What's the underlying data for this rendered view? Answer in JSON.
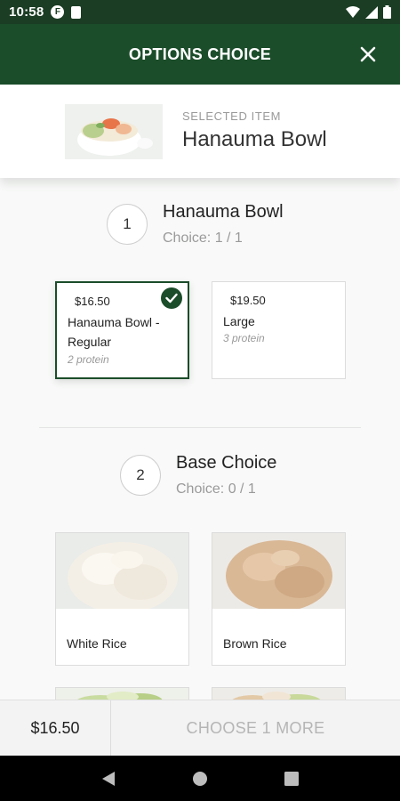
{
  "status_bar": {
    "time": "10:58",
    "app_icon_letter": "F",
    "icons": [
      "wifi-icon",
      "signal-icon",
      "battery-icon"
    ]
  },
  "app_bar": {
    "title": "OPTIONS CHOICE",
    "close_icon": "close-icon"
  },
  "selected_item": {
    "label": "SELECTED ITEM",
    "name": "Hanauma Bowl"
  },
  "sections": [
    {
      "step": "1",
      "title": "Hanauma Bowl",
      "choice_count": "Choice: 1 / 1",
      "options": [
        {
          "price": "$16.50",
          "name": "Hanauma Bowl - Regular",
          "sub": "2 protein",
          "selected": true
        },
        {
          "price": "$19.50",
          "name": "Large",
          "sub": "3 protein",
          "selected": false
        }
      ]
    },
    {
      "step": "2",
      "title": "Base Choice",
      "choice_count": "Choice: 0 / 1",
      "options": [
        {
          "name": "White Rice"
        },
        {
          "name": "Brown Rice"
        }
      ]
    }
  ],
  "footer": {
    "total": "$16.50",
    "action": "CHOOSE 1 MORE"
  },
  "colors": {
    "brand_green": "#1b4d2a",
    "status_bar": "#1b3d24"
  }
}
